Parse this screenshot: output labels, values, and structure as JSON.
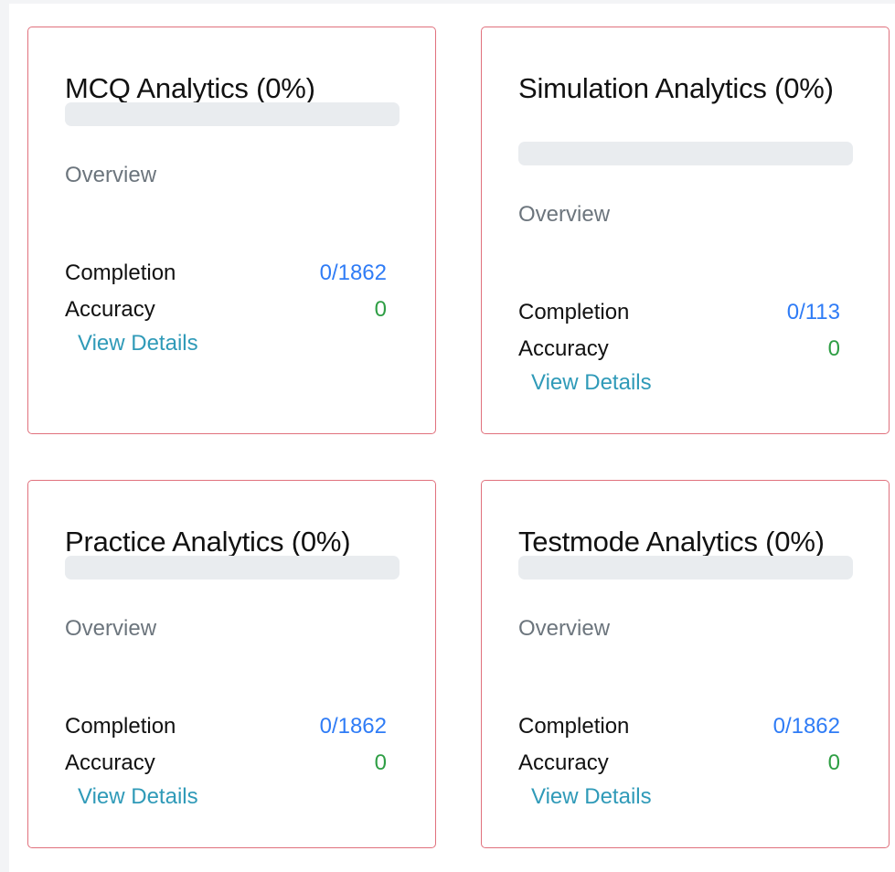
{
  "cards": [
    {
      "title": "MCQ Analytics (0%)",
      "progress": 0,
      "overview_label": "Overview",
      "completion_label": "Completion",
      "completion_value": "0/1862",
      "accuracy_label": "Accuracy",
      "accuracy_value": "0",
      "link_label": "View Details"
    },
    {
      "title": "Simulation Analytics (0%)",
      "progress": 0,
      "overview_label": "Overview",
      "completion_label": "Completion",
      "completion_value": "0/113",
      "accuracy_label": "Accuracy",
      "accuracy_value": "0",
      "link_label": "View Details"
    },
    {
      "title": "Practice Analytics (0%)",
      "progress": 0,
      "overview_label": "Overview",
      "completion_label": "Completion",
      "completion_value": "0/1862",
      "accuracy_label": "Accuracy",
      "accuracy_value": "0",
      "link_label": "View Details"
    },
    {
      "title": "Testmode Analytics (0%)",
      "progress": 0,
      "overview_label": "Overview",
      "completion_label": "Completion",
      "completion_value": "0/1862",
      "accuracy_label": "Accuracy",
      "accuracy_value": "0",
      "link_label": "View Details"
    }
  ],
  "colors": {
    "card_border": "#e0717d",
    "completion_value": "#2f7cf6",
    "accuracy_value": "#2e9e44",
    "link": "#2f9ab8",
    "progress_track": "#e9ecef",
    "muted_text": "#6c757d"
  }
}
